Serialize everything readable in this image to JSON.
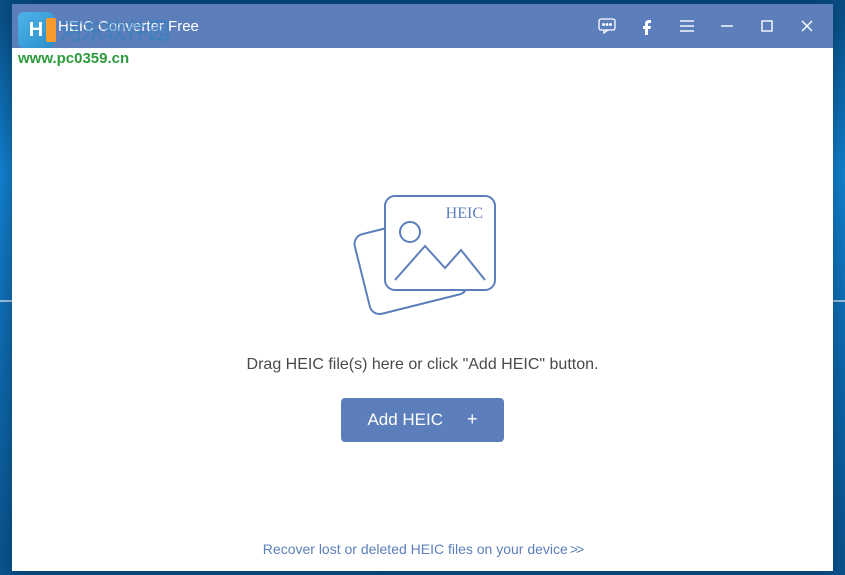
{
  "titlebar": {
    "app_title": "HEIC Converter Free"
  },
  "watermark": {
    "cn_text": "河东软件园",
    "url": "www.pc0359.cn"
  },
  "main": {
    "heic_label": "HEIC",
    "drop_text": "Drag HEIC file(s) here or click \"Add HEIC\" button.",
    "add_button_label": "Add HEIC",
    "plus_symbol": "+"
  },
  "footer": {
    "recover_link": "Recover lost or deleted HEIC files on your device",
    "arrows": ">>"
  }
}
